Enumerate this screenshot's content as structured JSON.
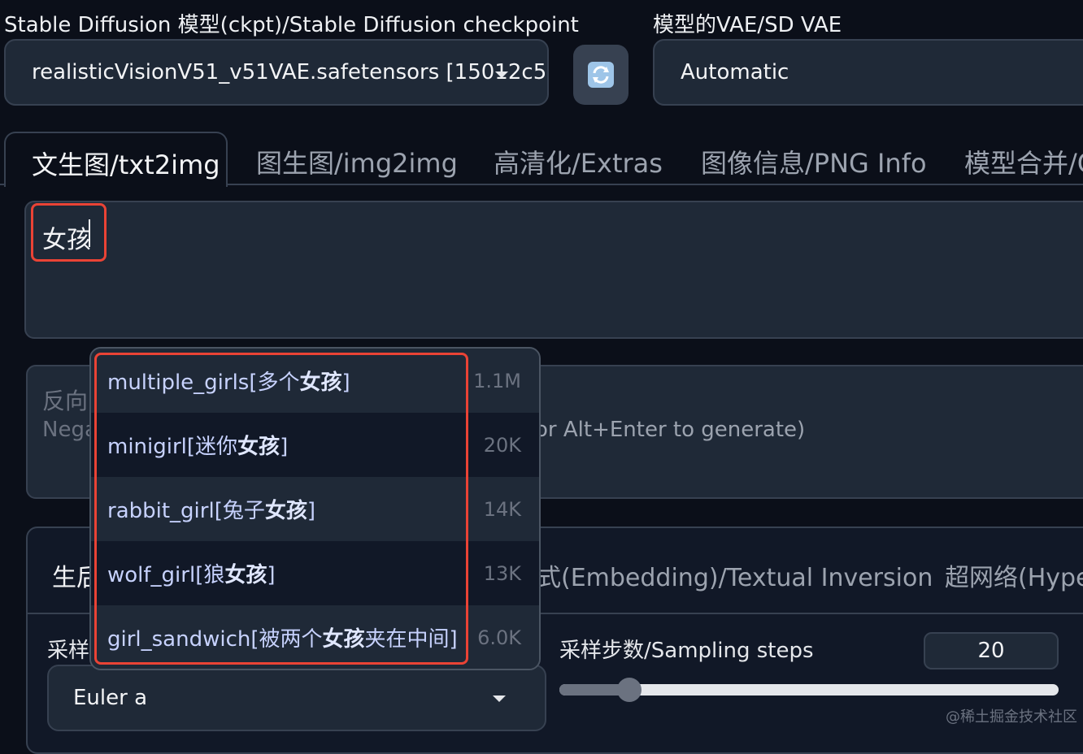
{
  "header": {
    "checkpoint_label": "Stable Diffusion 模型(ckpt)/Stable Diffusion checkpoint",
    "checkpoint_value": "realisticVisionV51_v51VAE.safetensors [15012c5",
    "vae_label": "模型的VAE/SD VAE",
    "vae_value": "Automatic",
    "refresh_icon": "refresh-icon"
  },
  "tabs": [
    {
      "label": "文生图/txt2img",
      "active": true
    },
    {
      "label": "图生图/img2img",
      "active": false
    },
    {
      "label": "高清化/Extras",
      "active": false
    },
    {
      "label": "图像信息/PNG Info",
      "active": false
    },
    {
      "label": "模型合并/C",
      "active": false
    }
  ],
  "prompt": {
    "value": "女孩"
  },
  "negative_prompt": {
    "label_visible": "反向",
    "placeholder_prefix": "Nega",
    "placeholder_suffix": "or Alt+Enter to generate)"
  },
  "autocomplete": {
    "items": [
      {
        "prefix": "multiple_girls[多个",
        "match": "女孩",
        "suffix": "]",
        "count": "1.1M"
      },
      {
        "prefix": "minigirl[迷你",
        "match": "女孩",
        "suffix": "]",
        "count": "20K"
      },
      {
        "prefix": "rabbit_girl[兔子",
        "match": "女孩",
        "suffix": "]",
        "count": "14K"
      },
      {
        "prefix": "wolf_girl[狼",
        "match": "女孩",
        "suffix": "]",
        "count": "13K"
      },
      {
        "prefix": "girl_sandwich[被两个",
        "match": "女孩",
        "suffix": "夹在中间]",
        "count": "6.0K"
      }
    ]
  },
  "subtabs": {
    "first_partial": "生后",
    "embedding": "式(Embedding)/Textual Inversion",
    "hypernet": "超网络(Hype"
  },
  "sampler": {
    "label_partial": "采样",
    "value": "Euler a"
  },
  "steps": {
    "label": "采样步数/Sampling steps",
    "value": "20",
    "level": 0.2
  },
  "watermark": "@稀土掘金技术社区",
  "colors": {
    "highlight": "#ea4335",
    "background": "#0b0f19"
  }
}
